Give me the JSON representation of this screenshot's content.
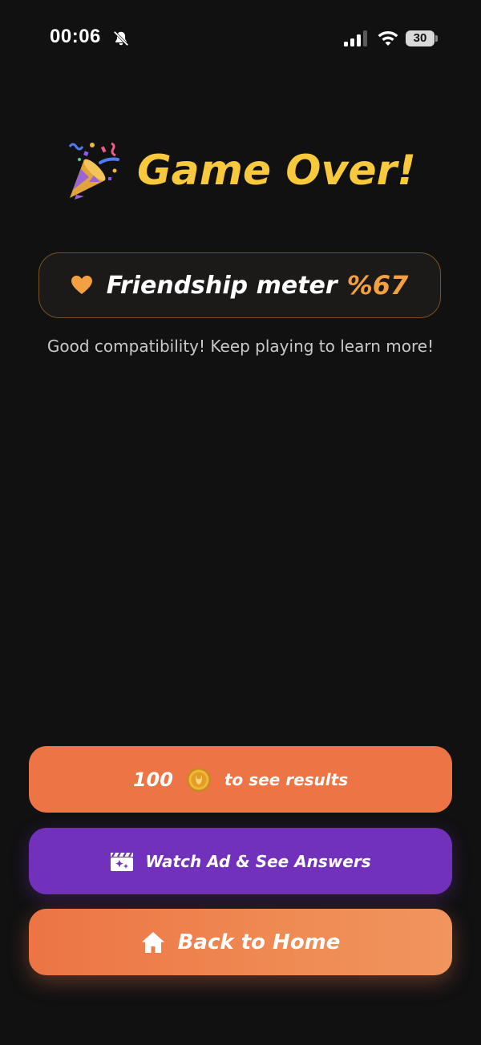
{
  "status_bar": {
    "time": "00:06",
    "battery": "30",
    "icons": [
      "bell-muted-icon",
      "signal-icon",
      "wifi-icon",
      "battery-icon"
    ]
  },
  "header": {
    "title": "Game Over!",
    "icon": "party-popper-icon"
  },
  "meter": {
    "icon": "heart-icon",
    "label": "Friendship meter",
    "value": "%67",
    "message": "Good compatibility! Keep playing to learn more!"
  },
  "actions": {
    "results": {
      "amount": "100",
      "icon": "coin-icon",
      "label": "to see results"
    },
    "watch_ad": {
      "icon": "clapper-icon",
      "label": "Watch Ad & See Answers"
    },
    "home": {
      "icon": "home-icon",
      "label": "Back to Home"
    }
  },
  "colors": {
    "background": "#111112",
    "title": "#f8c93c",
    "accent_orange": "#ec7445",
    "meter_value": "#f3a042",
    "watch_ad": "#7231bb"
  }
}
